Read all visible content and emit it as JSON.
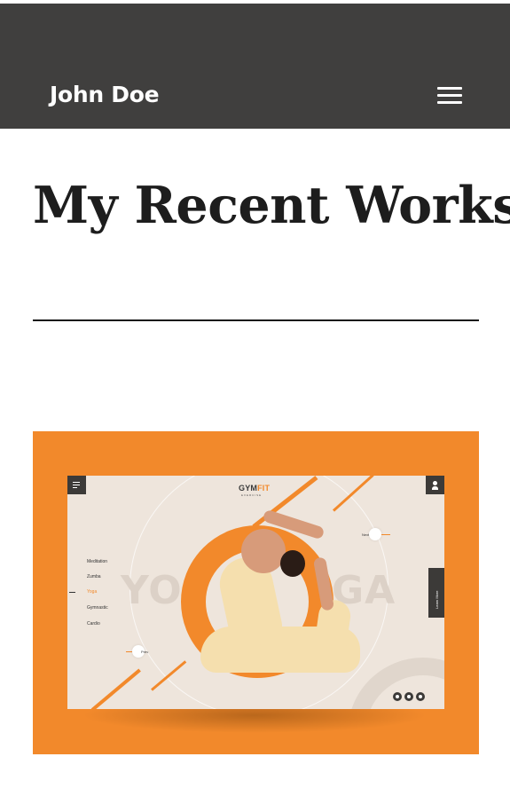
{
  "header": {
    "brand": "John Doe",
    "menu_icon": "hamburger-menu-icon"
  },
  "main": {
    "title": "My Recent Works"
  },
  "portfolio": {
    "items": [
      {
        "logo_text_a": "GYM",
        "logo_text_b": "FIT",
        "logo_sub": "EXERCISE",
        "ghost_left": "YO",
        "ghost_right": "GA",
        "nav": [
          "Meditation",
          "Zumba",
          "Yoga",
          "Gymnastic",
          "Cardio"
        ],
        "active_nav": "Yoga",
        "next_label": "Next",
        "prev_label": "Prev",
        "learn_more": "Learn More",
        "social_icons": [
          "facebook-icon",
          "twitter-icon",
          "instagram-icon"
        ],
        "accent": "#f2892b",
        "background": "#eee5dc"
      }
    ]
  },
  "colors": {
    "header_bg": "#403f3e",
    "accent": "#f2892b",
    "title": "#1d1d1d"
  }
}
